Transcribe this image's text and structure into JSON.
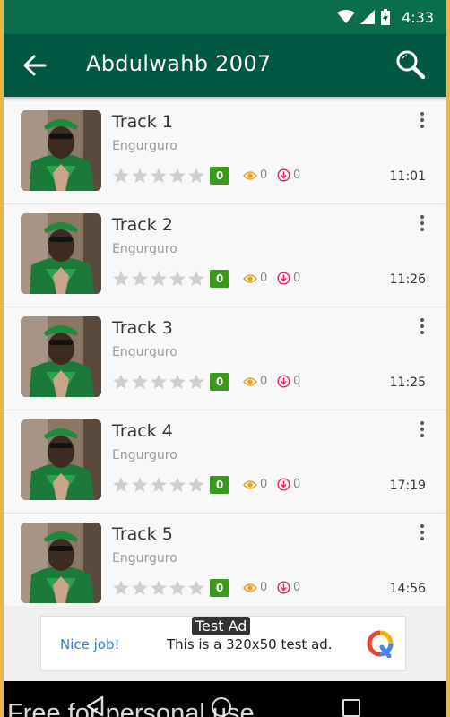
{
  "status_bar": {
    "time": "4:33"
  },
  "app_bar": {
    "title": "Abdulwahb 2007"
  },
  "tracks": [
    {
      "title": "Track 1",
      "artist": "Engurguro",
      "rating": "0",
      "views": "0",
      "downloads": "0",
      "duration": "11:01"
    },
    {
      "title": "Track 2",
      "artist": "Engurguro",
      "rating": "0",
      "views": "0",
      "downloads": "0",
      "duration": "11:26"
    },
    {
      "title": "Track 3",
      "artist": "Engurguro",
      "rating": "0",
      "views": "0",
      "downloads": "0",
      "duration": "11:25"
    },
    {
      "title": "Track 4",
      "artist": "Engurguro",
      "rating": "0",
      "views": "0",
      "downloads": "0",
      "duration": "17:19"
    },
    {
      "title": "Track 5",
      "artist": "Engurguro",
      "rating": "0",
      "views": "0",
      "downloads": "0",
      "duration": "14:56"
    }
  ],
  "ad": {
    "tag": "Test Ad",
    "left_text": "Nice job!",
    "body_text": "This is a 320x50 test ad."
  },
  "watermark": "Free for personal use",
  "colors": {
    "status_bar": "#0a6e4d",
    "app_bar": "#005842",
    "rating_badge": "#3a9a1c",
    "views_icon": "#f0a020",
    "downloads_icon": "#e0245e",
    "ad_link": "#3a79e0"
  },
  "icons": {
    "back": "arrow-left-icon",
    "search": "magnifier-icon",
    "more": "vertical-dots-icon",
    "star": "star-icon",
    "views": "eye-icon",
    "downloads": "download-icon"
  }
}
